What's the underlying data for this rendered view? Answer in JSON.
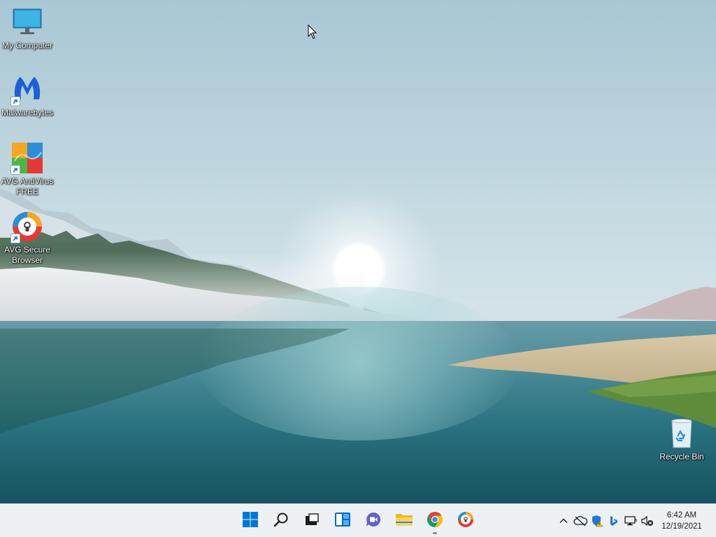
{
  "desktop": {
    "icons": [
      {
        "label": "My Computer",
        "icon": "monitor-icon"
      },
      {
        "label": "Malwarebytes",
        "icon": "malwarebytes-icon"
      },
      {
        "label": "AVG AntiVirus\nFREE",
        "icon": "avg-antivirus-icon"
      },
      {
        "label": "AVG Secure\nBrowser",
        "icon": "avg-secure-browser-icon"
      },
      {
        "label": "Recycle Bin",
        "icon": "recycle-bin-icon"
      }
    ]
  },
  "taskbar": {
    "pinned": [
      {
        "name": "start",
        "icon": "windows-logo-icon"
      },
      {
        "name": "search",
        "icon": "search-icon"
      },
      {
        "name": "task-view",
        "icon": "task-view-icon"
      },
      {
        "name": "widgets",
        "icon": "widgets-icon"
      },
      {
        "name": "chat",
        "icon": "teams-chat-icon"
      },
      {
        "name": "file-explorer",
        "icon": "folder-icon"
      },
      {
        "name": "chrome",
        "icon": "chrome-icon",
        "running": true
      },
      {
        "name": "avg-secure-browser",
        "icon": "avg-secure-browser-icon"
      }
    ],
    "tray": [
      "chevron-up-icon",
      "onedrive-offline-icon",
      "security-warning-icon",
      "bing-icon",
      "network-icon",
      "volume-muted-icon"
    ],
    "clock": {
      "time": "6:42 AM",
      "date": "12/19/2021"
    }
  },
  "colors": {
    "taskbar_bg": "#eef1f4",
    "windows_blue": "#0078d4",
    "malwarebytes_blue": "#1c5fd6"
  }
}
